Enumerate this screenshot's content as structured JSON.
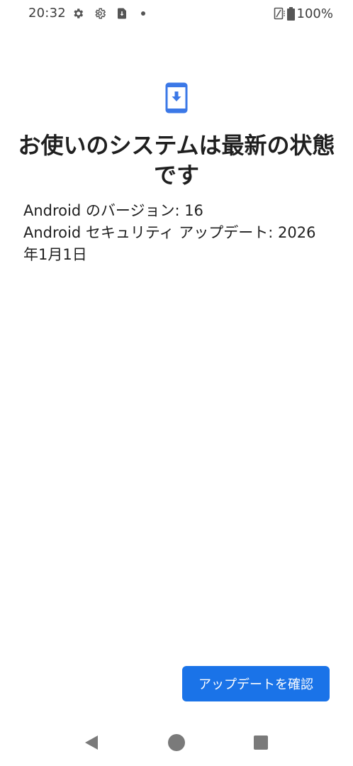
{
  "status_bar": {
    "time": "20:32",
    "battery_percent": "100%",
    "icons": [
      "gear-icon",
      "settings-icon",
      "download-icon",
      "dot-icon",
      "no-sim-icon",
      "battery-icon"
    ]
  },
  "main": {
    "icon": "system-update-icon",
    "title": "お使いのシステムは最新の状態です",
    "android_version": "Android のバージョン: 16",
    "security_update": "Android セキュリティ アップデート: 2026年1月1日"
  },
  "actions": {
    "check_update_label": "アップデートを確認"
  },
  "nav_bar": {
    "icons": [
      "back-icon",
      "home-icon",
      "recents-icon"
    ]
  },
  "colors": {
    "accent": "#1a73e8",
    "icon_blue": "#3b78e7",
    "text": "#1f1f1f"
  }
}
